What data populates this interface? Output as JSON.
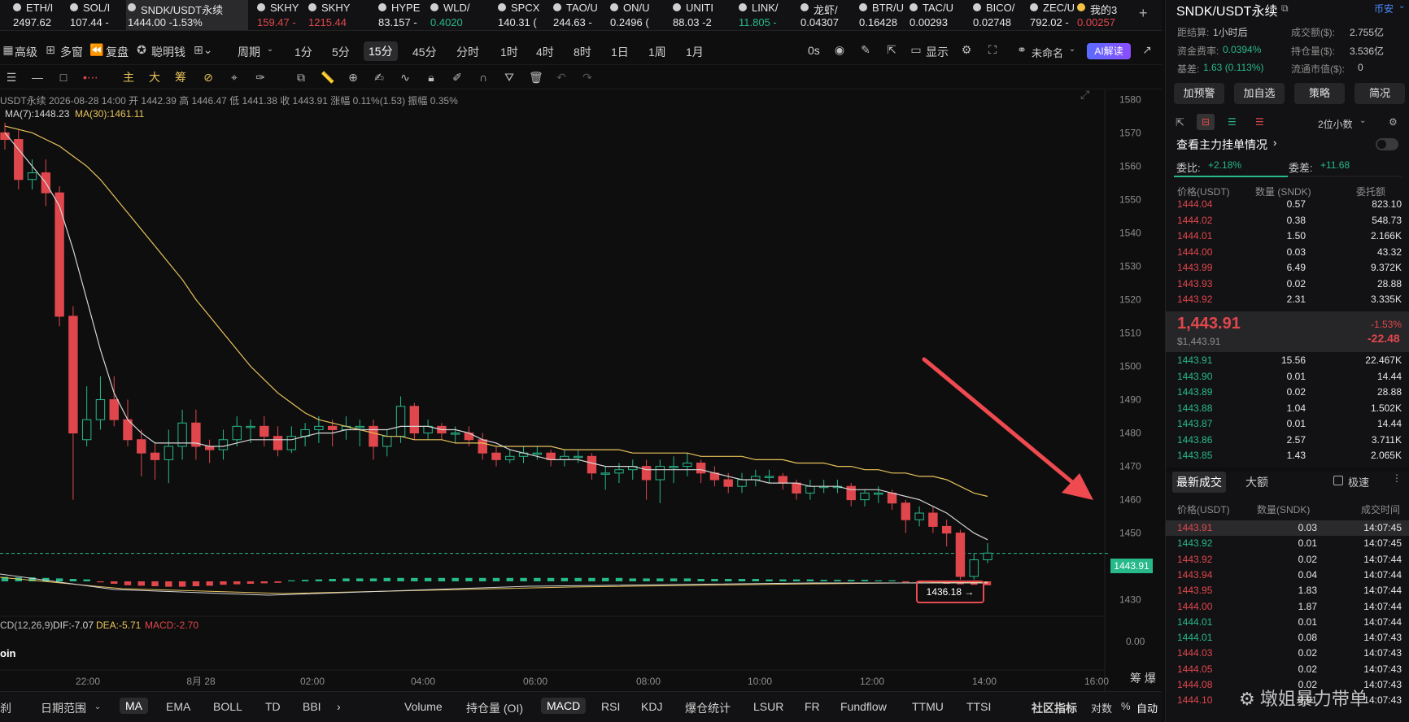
{
  "ticker": [
    {
      "name": "ETH/I",
      "price": "2497.62",
      "color": "white"
    },
    {
      "name": "SOL/I",
      "price": "107.44 -",
      "color": "white"
    },
    {
      "name": "SNDK/USDT永续",
      "price": "1444.00 -1.53%",
      "color": "white",
      "active": true
    },
    {
      "name": "SKHY",
      "price": "159.47 -",
      "color": "red"
    },
    {
      "name": "SKHY",
      "price": "1215.44",
      "color": "red"
    },
    {
      "name": "HYPE",
      "price": "83.157 -",
      "color": "white"
    },
    {
      "name": "WLD/",
      "price": "0.4020",
      "color": "green"
    },
    {
      "name": "SPCX",
      "price": "140.31 (",
      "color": "white"
    },
    {
      "name": "TAO/U",
      "price": "244.63 -",
      "color": "white"
    },
    {
      "name": "ON/U",
      "price": "0.2496 (",
      "color": "white"
    },
    {
      "name": "UNITI",
      "price": "88.03 -2",
      "color": "white"
    },
    {
      "name": "LINK/",
      "price": "11.805 -",
      "color": "green"
    },
    {
      "name": "龙虾/",
      "price": "0.04307",
      "color": "white"
    },
    {
      "name": "BTR/U",
      "price": "0.16428",
      "color": "white"
    },
    {
      "name": "TAC/U",
      "price": "0.00293",
      "color": "white"
    },
    {
      "name": "BICO/",
      "price": "0.02748",
      "color": "white"
    },
    {
      "name": "ZEC/U",
      "price": "792.02 -",
      "color": "white"
    },
    {
      "name": "我的3",
      "price": "0.00257",
      "color": "red"
    }
  ],
  "toolbar": {
    "items": [
      "高级",
      "多窗",
      "复盘",
      "聪明钱",
      "周期",
      "1分",
      "5分",
      "15分",
      "45分",
      "分时",
      "1时",
      "4时",
      "8时",
      "1日",
      "1周",
      "1月"
    ],
    "selected": "15分",
    "countdown": "0s",
    "display": "显示",
    "layout_name": "未命名",
    "ai": "AI解读"
  },
  "chart_info": {
    "ohlc": "USDT永续 2026-08-28 14:00 开 1442.39 高 1446.47 低 1441.38 收 1443.91 涨幅 0.11%(1.53) 振幅 0.35%",
    "ma7": "MA(7):1448.23",
    "ma30": "MA(30):1461.11",
    "macd": "CD(12,26,9)",
    "dif": "DIF:-7.07",
    "dea": "DEA:-5.71",
    "macd_val": "MACD:-2.70",
    "coin_label": "oin",
    "last_price": "1443.91",
    "low_label": "1436.18 →",
    "footer_right": "筹 爆"
  },
  "chart_data": {
    "type": "candlestick",
    "y_ticks": [
      1580,
      1570,
      1560,
      1550,
      1540,
      1530,
      1520,
      1510,
      1500,
      1490,
      1480,
      1470,
      1460,
      1450,
      1440,
      1430
    ],
    "ylim": [
      1427,
      1583
    ],
    "x_ticks": [
      "22:00",
      "8月 28",
      "02:00",
      "04:00",
      "06:00",
      "08:00",
      "10:00",
      "12:00",
      "14:00",
      "16:00"
    ],
    "macd_zero": "0.00",
    "ma_colors": {
      "ma7": "#d6d6d6",
      "ma30": "#e8c35a"
    },
    "candles": [
      [
        1570,
        1568,
        1573,
        1565
      ],
      [
        1568,
        1556,
        1571,
        1553
      ],
      [
        1556,
        1558,
        1562,
        1553
      ],
      [
        1558,
        1552,
        1562,
        1548
      ],
      [
        1552,
        1515,
        1554,
        1512
      ],
      [
        1515,
        1480,
        1518,
        1460
      ],
      [
        1478,
        1484,
        1494,
        1476
      ],
      [
        1484,
        1490,
        1497,
        1481
      ],
      [
        1490,
        1484,
        1497,
        1482
      ],
      [
        1484,
        1478,
        1490,
        1476
      ],
      [
        1478,
        1474,
        1481,
        1467
      ],
      [
        1474,
        1472,
        1477,
        1466
      ],
      [
        1472,
        1476,
        1481,
        1465
      ],
      [
        1476,
        1483,
        1487,
        1472
      ],
      [
        1483,
        1476,
        1487,
        1472
      ],
      [
        1476,
        1475,
        1478,
        1471
      ],
      [
        1475,
        1478,
        1481,
        1472
      ],
      [
        1478,
        1482,
        1485,
        1476
      ],
      [
        1482,
        1482,
        1484,
        1477
      ],
      [
        1482,
        1479,
        1485,
        1476
      ],
      [
        1479,
        1475,
        1482,
        1473
      ],
      [
        1475,
        1479,
        1482,
        1474
      ],
      [
        1479,
        1481,
        1483,
        1476
      ],
      [
        1481,
        1482,
        1485,
        1477
      ],
      [
        1482,
        1481,
        1484,
        1476
      ],
      [
        1481,
        1482,
        1485,
        1478
      ],
      [
        1482,
        1482,
        1484,
        1476
      ],
      [
        1482,
        1476,
        1484,
        1472
      ],
      [
        1476,
        1479,
        1481,
        1473
      ],
      [
        1479,
        1488,
        1491,
        1477
      ],
      [
        1488,
        1480,
        1489,
        1478
      ],
      [
        1480,
        1482,
        1484,
        1478
      ],
      [
        1482,
        1480,
        1483,
        1478
      ],
      [
        1480,
        1480,
        1482,
        1477
      ],
      [
        1480,
        1478,
        1482,
        1476
      ],
      [
        1478,
        1474,
        1480,
        1472
      ],
      [
        1474,
        1472,
        1476,
        1470
      ],
      [
        1472,
        1473,
        1475,
        1471
      ],
      [
        1473,
        1474,
        1476,
        1471
      ],
      [
        1474,
        1474,
        1476,
        1472
      ],
      [
        1474,
        1472,
        1475,
        1470
      ],
      [
        1472,
        1473,
        1475,
        1470
      ],
      [
        1473,
        1473,
        1475,
        1471
      ],
      [
        1473,
        1468,
        1474,
        1466
      ],
      [
        1468,
        1468,
        1470,
        1463
      ],
      [
        1468,
        1469,
        1471,
        1465
      ],
      [
        1469,
        1470,
        1472,
        1466
      ],
      [
        1470,
        1466,
        1472,
        1460
      ],
      [
        1466,
        1470,
        1472,
        1459
      ],
      [
        1470,
        1470,
        1473,
        1465
      ],
      [
        1470,
        1471,
        1474,
        1467
      ],
      [
        1471,
        1468,
        1472,
        1465
      ],
      [
        1468,
        1466,
        1470,
        1464
      ],
      [
        1466,
        1464,
        1468,
        1462
      ],
      [
        1464,
        1466,
        1468,
        1462
      ],
      [
        1466,
        1467,
        1469,
        1464
      ],
      [
        1467,
        1467,
        1469,
        1465
      ],
      [
        1467,
        1465,
        1468,
        1463
      ],
      [
        1465,
        1462,
        1466,
        1460
      ],
      [
        1462,
        1464,
        1466,
        1460
      ],
      [
        1464,
        1464,
        1466,
        1462
      ],
      [
        1464,
        1464,
        1466,
        1462
      ],
      [
        1464,
        1460,
        1465,
        1458
      ],
      [
        1460,
        1462,
        1463,
        1458
      ],
      [
        1462,
        1462,
        1464,
        1459
      ],
      [
        1462,
        1459,
        1463,
        1457
      ],
      [
        1459,
        1454,
        1460,
        1450
      ],
      [
        1454,
        1456,
        1458,
        1452
      ],
      [
        1456,
        1452,
        1458,
        1450
      ],
      [
        1452,
        1450,
        1454,
        1446
      ],
      [
        1450,
        1437,
        1451,
        1436
      ],
      [
        1437,
        1442,
        1444,
        1436
      ],
      [
        1442,
        1444,
        1447,
        1441
      ]
    ],
    "ma7": [
      1570,
      1565,
      1560,
      1555,
      1548,
      1535,
      1520,
      1505,
      1492,
      1484,
      1480,
      1477,
      1477,
      1477,
      1477,
      1476,
      1476,
      1477,
      1478,
      1478,
      1478,
      1478,
      1479,
      1480,
      1480,
      1481,
      1481,
      1481,
      1481,
      1482,
      1482,
      1482,
      1481,
      1481,
      1480,
      1478,
      1477,
      1475,
      1474,
      1473,
      1472,
      1472,
      1472,
      1471,
      1470,
      1470,
      1470,
      1469,
      1469,
      1469,
      1469,
      1469,
      1468,
      1467,
      1466,
      1466,
      1465,
      1465,
      1465,
      1464,
      1464,
      1464,
      1463,
      1463,
      1463,
      1462,
      1461,
      1460,
      1458,
      1456,
      1453,
      1450,
      1448
    ],
    "ma30": [
      1572,
      1571,
      1570,
      1568,
      1566,
      1563,
      1560,
      1556,
      1551,
      1546,
      1541,
      1536,
      1531,
      1526,
      1520,
      1515,
      1510,
      1505,
      1500,
      1496,
      1492,
      1489,
      1486,
      1484,
      1483,
      1482,
      1481,
      1480,
      1479,
      1479,
      1478,
      1478,
      1478,
      1477,
      1477,
      1477,
      1476,
      1476,
      1476,
      1476,
      1476,
      1475,
      1475,
      1475,
      1475,
      1475,
      1474,
      1474,
      1474,
      1474,
      1474,
      1473,
      1473,
      1473,
      1473,
      1472,
      1472,
      1472,
      1471,
      1471,
      1471,
      1470,
      1470,
      1469,
      1469,
      1468,
      1468,
      1467,
      1467,
      1466,
      1464,
      1462,
      1461
    ],
    "macd_hist": [
      0.9,
      0.8,
      0.8,
      0.7,
      0.6,
      0.5,
      0.4,
      -0.2,
      -0.5,
      -0.8,
      -0.9,
      -1.0,
      -1.1,
      -1.1,
      -1.0,
      -0.9,
      -0.7,
      -0.6,
      -0.5,
      -0.4,
      -0.3,
      0.2,
      0.3,
      0.4,
      0.5,
      0.6,
      0.6,
      0.6,
      0.7,
      0.7,
      0.7,
      0.7,
      0.7,
      0.7,
      0.7,
      0.7,
      0.7,
      0.7,
      0.7,
      0.7,
      0.7,
      0.7,
      0.7,
      0.7,
      0.7,
      0.7,
      0.6,
      0.6,
      0.6,
      0.6,
      0.6,
      0.5,
      0.5,
      0.5,
      0.5,
      0.5,
      0.4,
      0.4,
      0.4,
      0.4,
      0.3,
      0.3,
      0.3,
      0.3,
      0.2,
      0.2,
      -0.2,
      -0.3,
      -0.4,
      -0.5,
      -0.6,
      -0.7,
      -0.8
    ]
  },
  "bottom": {
    "left": [
      "刹",
      "日期范围"
    ],
    "indicators": [
      "MA",
      "EMA",
      "BOLL",
      "TD",
      "BBI",
      "Volume",
      "持仓量 (OI)",
      "MACD",
      "RSI",
      "KDJ",
      "爆仓统计",
      "LSUR",
      "FR",
      "Fundflow",
      "TTMU",
      "TTSI"
    ],
    "selected_main": "MA",
    "selected_sub": "MACD",
    "community": "社区指标",
    "log": "对数",
    "pct": "%",
    "auto": "自动",
    "watermark": "墩姐暴力带单"
  },
  "panel": {
    "title": "SNDK/USDT永续",
    "exchange": "币安",
    "stats": [
      {
        "label": "距结算:",
        "value": "1小时后",
        "color": "white"
      },
      {
        "label": "成交额($):",
        "value": "2.755亿",
        "color": "white"
      },
      {
        "label": "资金费率:",
        "value": "0.0394%",
        "color": "green"
      },
      {
        "label": "持仓量($):",
        "value": "3.536亿",
        "color": "white"
      },
      {
        "label": "基差:",
        "value": "1.63 (0.113%)",
        "color": "green"
      },
      {
        "label": "流通市值($):",
        "value": "0",
        "color": "white"
      }
    ],
    "buttons": [
      "加预警",
      "加自选",
      "策略",
      "简况"
    ],
    "decimals": "2位小数",
    "orderbook_title": "查看主力挂单情况",
    "bid_ratio_label": "委比:",
    "bid_ratio": "+2.18%",
    "bid_diff_label": "委差:",
    "bid_diff": "+11.68",
    "ob_headers": [
      "价格(USDT)",
      "数量 (SNDK)",
      "委托额"
    ],
    "asks": [
      [
        "1444.04",
        "0.57",
        "823.10"
      ],
      [
        "1444.02",
        "0.38",
        "548.73"
      ],
      [
        "1444.01",
        "1.50",
        "2.166K"
      ],
      [
        "1444.00",
        "0.03",
        "43.32"
      ],
      [
        "1443.99",
        "6.49",
        "9.372K"
      ],
      [
        "1443.93",
        "0.02",
        "28.88"
      ],
      [
        "1443.92",
        "2.31",
        "3.335K"
      ]
    ],
    "mid_price": "1,443.91",
    "mid_usd": "$1,443.91",
    "mid_pct": "-1.53%",
    "mid_chg": "-22.48",
    "bids": [
      [
        "1443.91",
        "15.56",
        "22.467K"
      ],
      [
        "1443.90",
        "0.01",
        "14.44"
      ],
      [
        "1443.89",
        "0.02",
        "28.88"
      ],
      [
        "1443.88",
        "1.04",
        "1.502K"
      ],
      [
        "1443.87",
        "0.01",
        "14.44"
      ],
      [
        "1443.86",
        "2.57",
        "3.711K"
      ],
      [
        "1443.85",
        "1.43",
        "2.065K"
      ]
    ],
    "trade_tabs": [
      "最新成交",
      "大额"
    ],
    "fast": "极速",
    "trade_headers": [
      "价格(USDT)",
      "数量(SNDK)",
      "成交时间"
    ],
    "trades": [
      [
        "1443.91",
        "0.03",
        "14:07:45",
        "red"
      ],
      [
        "1443.92",
        "0.01",
        "14:07:45",
        "green"
      ],
      [
        "1443.92",
        "0.02",
        "14:07:44",
        "red"
      ],
      [
        "1443.94",
        "0.04",
        "14:07:44",
        "red"
      ],
      [
        "1443.95",
        "1.83",
        "14:07:44",
        "red"
      ],
      [
        "1444.00",
        "1.87",
        "14:07:44",
        "red"
      ],
      [
        "1444.01",
        "0.01",
        "14:07:44",
        "green"
      ],
      [
        "1444.01",
        "0.08",
        "14:07:43",
        "green"
      ],
      [
        "1444.03",
        "0.02",
        "14:07:43",
        "red"
      ],
      [
        "1444.05",
        "0.02",
        "14:07:43",
        "red"
      ],
      [
        "1444.08",
        "0.02",
        "14:07:43",
        "red"
      ],
      [
        "1444.10",
        "0.01",
        "14:07:43",
        "red"
      ]
    ]
  }
}
